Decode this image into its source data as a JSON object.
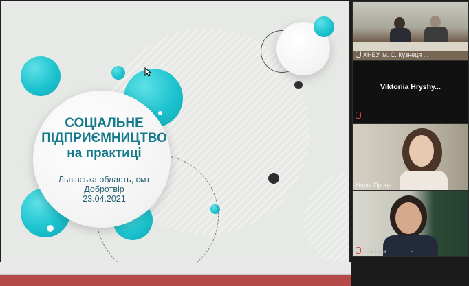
{
  "slide": {
    "title_lines": [
      "СОЦІАЛЬНЕ",
      "ПІДПРИЄМНИЦТВО",
      "на практиці"
    ],
    "subtitle_lines": [
      "Львівська область, смт",
      "Добротвір",
      "23.04.2021"
    ]
  },
  "participants": [
    {
      "name": "ХНЕУ ім. С. Кузнеця ..."
    },
    {
      "name": "Viktoriia  Hryshy..."
    },
    {
      "name": "Надія Проць"
    },
    {
      "name": "...ia Lola"
    }
  ],
  "colors": {
    "accent_teal": "#1cc3cf",
    "title_teal": "#167a8c",
    "slide_bg": "#e6e9e5",
    "sidebar_bg": "#1b1b1b"
  }
}
